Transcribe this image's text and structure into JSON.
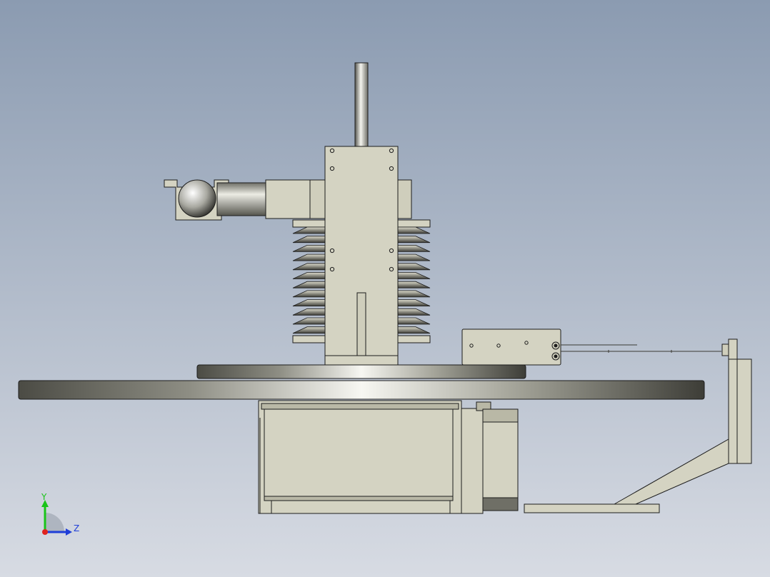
{
  "viewport": {
    "background_top": "#8b9bb1",
    "background_bottom": "#d7dbe3"
  },
  "colors": {
    "part_fill": "#d4d3c2",
    "part_fill_dark": "#b9b8a6",
    "edge": "#1c1c1c",
    "metal_light": "#f4f4ee",
    "metal_dark": "#3a3a34",
    "fin_dark": "#4a4a44"
  },
  "triad": {
    "y_label": "Y",
    "z_label": "Z",
    "y_axis_color": "#19c419",
    "z_axis_color": "#1f3ed8",
    "origin_color": "#e0231f"
  }
}
